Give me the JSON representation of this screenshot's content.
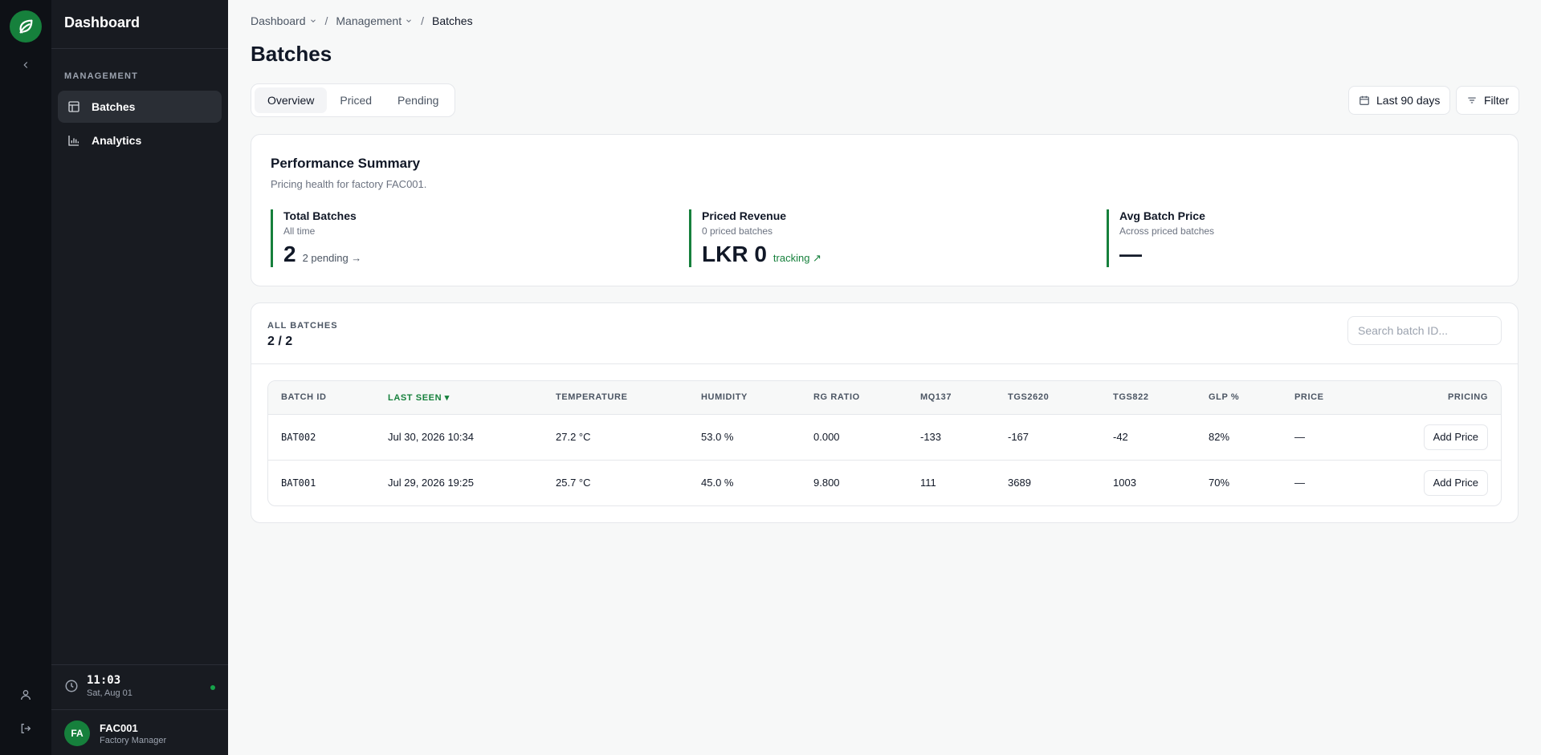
{
  "colors": {
    "accent": "#16803c",
    "rail": "#0e1116",
    "sidebar": "#181b21"
  },
  "sidebar": {
    "title": "Dashboard",
    "section": "MANAGEMENT",
    "items": [
      {
        "label": "Batches",
        "icon": "table-icon",
        "active": true
      },
      {
        "label": "Analytics",
        "icon": "bar-chart-icon",
        "active": false
      }
    ],
    "clock": {
      "time": "11:03",
      "date": "Sat, Aug 01"
    },
    "user": {
      "initials": "FA",
      "name": "FAC001",
      "role": "Factory Manager"
    }
  },
  "breadcrumb": {
    "items": [
      "Dashboard",
      "Management"
    ],
    "current": "Batches"
  },
  "page": {
    "title": "Batches"
  },
  "tabs": [
    "Overview",
    "Priced",
    "Pending"
  ],
  "toolbar": {
    "date_range": "Last 90 days",
    "filter": "Filter"
  },
  "summary": {
    "title": "Performance Summary",
    "subtitle": "Pricing health for factory FAC001.",
    "metrics": [
      {
        "label": "Total Batches",
        "sub": "All time",
        "value": "2",
        "note": "2 pending →"
      },
      {
        "label": "Priced Revenue",
        "sub": "0 priced batches",
        "value": "LKR 0",
        "note": "tracking ↗"
      },
      {
        "label": "Avg Batch Price",
        "sub": "Across priced batches",
        "value": "—",
        "note": ""
      }
    ]
  },
  "batches": {
    "label": "ALL BATCHES",
    "count": "2 / 2",
    "search_placeholder": "Search batch ID...",
    "columns": [
      "BATCH ID",
      "LAST SEEN ▾",
      "TEMPERATURE",
      "HUMIDITY",
      "RG RATIO",
      "MQ137",
      "TGS2620",
      "TGS822",
      "GLP %",
      "PRICE",
      "PRICING"
    ],
    "rows": [
      {
        "id": "BAT002",
        "last_seen": "Jul 30, 2026 10:34",
        "temperature": "27.2 °C",
        "humidity": "53.0 %",
        "rg_ratio": "0.000",
        "mq137": "-133",
        "tgs2620": "-167",
        "tgs822": "-42",
        "glp": "82%",
        "price": "—",
        "action": "Add Price"
      },
      {
        "id": "BAT001",
        "last_seen": "Jul 29, 2026 19:25",
        "temperature": "25.7 °C",
        "humidity": "45.0 %",
        "rg_ratio": "9.800",
        "mq137": "111",
        "tgs2620": "3689",
        "tgs822": "1003",
        "glp": "70%",
        "price": "—",
        "action": "Add Price"
      }
    ]
  }
}
